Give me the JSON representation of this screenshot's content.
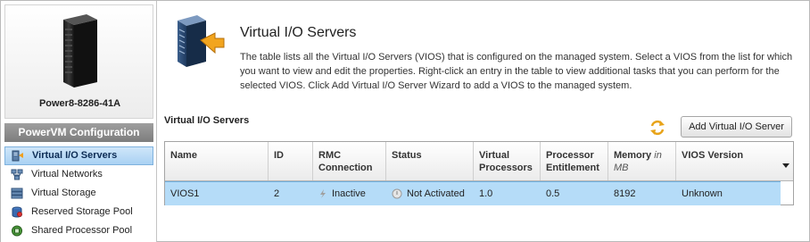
{
  "system": {
    "name": "Power8-8286-41A"
  },
  "sidebar": {
    "header": "PowerVM Configuration",
    "items": [
      {
        "label": "Virtual I/O Servers",
        "active": true,
        "icon": "vios-icon"
      },
      {
        "label": "Virtual Networks",
        "active": false,
        "icon": "network-icon"
      },
      {
        "label": "Virtual Storage",
        "active": false,
        "icon": "storage-icon"
      },
      {
        "label": "Reserved Storage Pool",
        "active": false,
        "icon": "storage-pool-icon"
      },
      {
        "label": "Shared Processor Pool",
        "active": false,
        "icon": "processor-pool-icon"
      }
    ]
  },
  "main": {
    "title": "Virtual I/O Servers",
    "description": "The table lists all the Virtual I/O Servers (VIOS) that is configured on the managed system. Select a VIOS from the list for which you want to view and edit the properties. Right-click an entry in the table to view additional tasks that you can perform for the selected VIOS. Click Add Virtual I/O Server Wizard to add a VIOS to the managed system.",
    "table_title": "Virtual I/O Servers",
    "add_button": "Add Virtual I/O Server",
    "refresh_icon": "refresh-icon"
  },
  "table": {
    "columns": {
      "name": "Name",
      "id": "ID",
      "rmc_1": "RMC",
      "rmc_2": "Connection",
      "status": "Status",
      "vp_1": "Virtual",
      "vp_2": "Processors",
      "pe_1": "Processor",
      "pe_2": "Entitlement",
      "mem": "Memory",
      "mem_unit": "in",
      "mem_unit_2": "MB",
      "vios_version": "VIOS Version"
    },
    "rows": [
      {
        "name": "VIOS1",
        "id": "2",
        "rmc": "Inactive",
        "status": "Not Activated",
        "virtual_processors": "1.0",
        "processor_entitlement": "0.5",
        "memory": "8192",
        "vios_version": "Unknown"
      }
    ]
  },
  "colors": {
    "selected_row": "#b5dcf8",
    "active_nav": "#a9d1f3",
    "section_header": "#8a8a8a"
  }
}
